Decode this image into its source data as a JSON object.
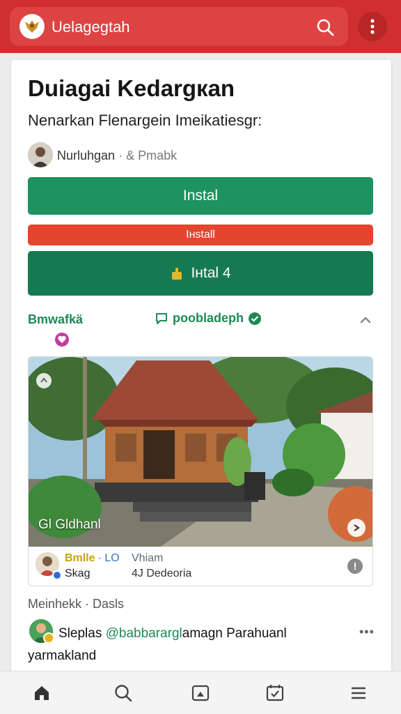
{
  "header": {
    "app_title": "Uelagegtah",
    "logo_icon": "eagle-emblem-icon",
    "search_icon": "search-icon",
    "menu_icon": "more-vertical-icon",
    "bar_color": "#cf2f2f"
  },
  "article": {
    "title": "Duiagai Kedargкan",
    "subtitle": "Nenarkan Flenargein Imeikatiesgr:",
    "author_name": "Nurluhgan",
    "author_meta": "· & Pmabk"
  },
  "buttons": {
    "primary_label": "Instal",
    "secondary_label": "Iнstall",
    "tertiary_label": "Iнtal 4",
    "primary_color": "#1e9361",
    "secondary_color": "#e3452e",
    "tertiary_color": "#167a50"
  },
  "section": {
    "left_label": "Bmwafkä",
    "mid_label": "poobladeph"
  },
  "post": {
    "image_caption": "Gl Gldhanl",
    "user_name": "Bmlle",
    "user_name_suffix": "· LO",
    "user_sub": "Skag",
    "col2_top": "Vhiam",
    "col2_bottom": "4J Dedeoria"
  },
  "comments": {
    "header": "Meinhekk · Dasls",
    "author": "Sleplas",
    "handle": "@babbarargl",
    "text_rest": "amagn Parahuanl",
    "continuation": "yarmakland"
  },
  "bottom_nav": [
    {
      "icon": "home-icon"
    },
    {
      "icon": "search-icon"
    },
    {
      "icon": "media-icon"
    },
    {
      "icon": "calendar-check-icon"
    },
    {
      "icon": "menu-lines-icon"
    }
  ]
}
